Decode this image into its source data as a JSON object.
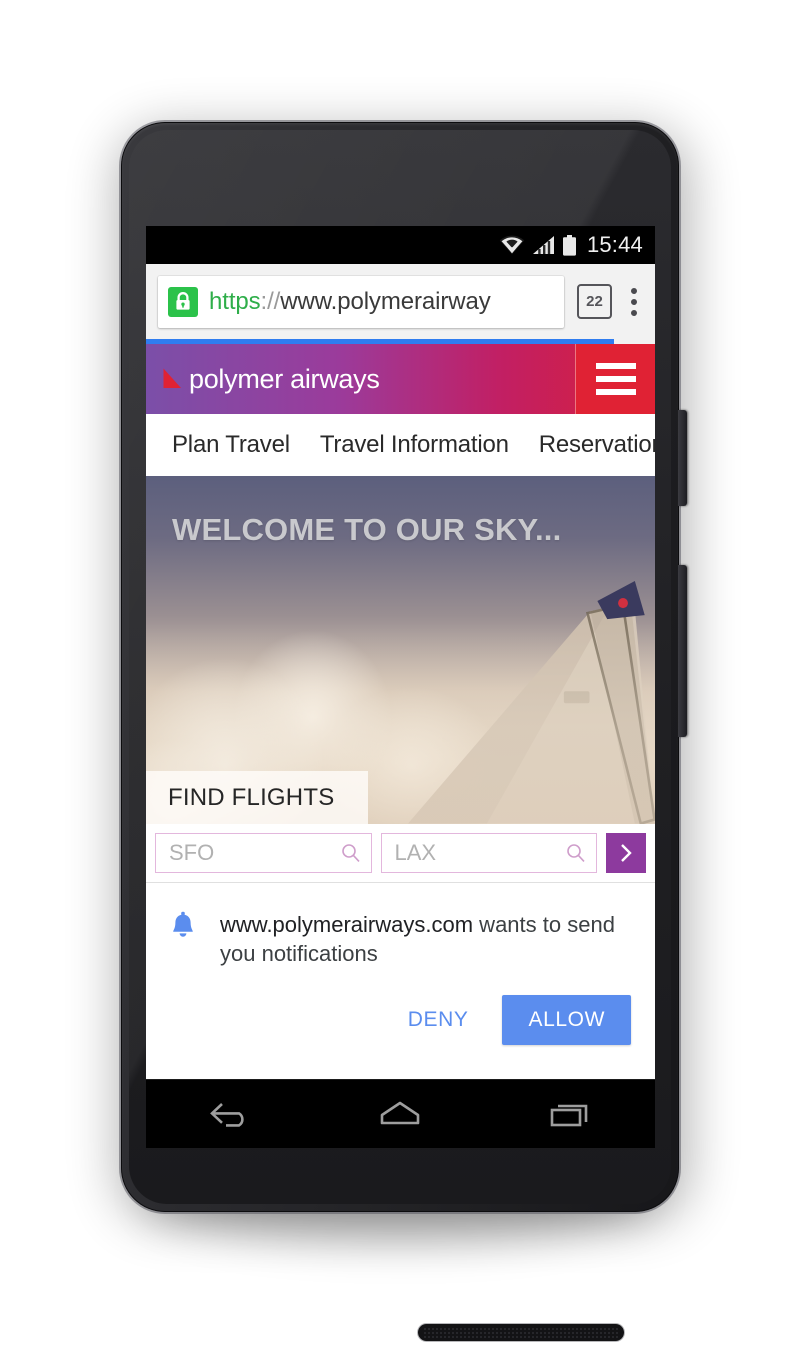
{
  "device": {
    "name": "android-phone",
    "hardware": {
      "front_camera": "front-camera",
      "earpiece": "earpiece-speaker",
      "bottom_speaker": "bottom-speaker",
      "power_button": "power-button",
      "volume_button": "volume-rocker"
    }
  },
  "status_bar": {
    "clock": "15:44",
    "icons": [
      "wifi-icon",
      "cellular-signal-icon",
      "battery-icon"
    ]
  },
  "browser": {
    "url": {
      "scheme": "https",
      "separator": "://",
      "host": "www.polymerairway",
      "full": "https://www.polymerairways.com"
    },
    "lock_icon": "lock-icon",
    "secure": true,
    "tab_count": "22",
    "menu_icon": "kebab-menu-icon",
    "progress_percent": 92,
    "progress_color": "#2f7df0"
  },
  "site": {
    "brand": {
      "name": "polymer airways",
      "logo_icon": "wing-logo-icon"
    },
    "menu_button_label": "hamburger-menu-icon",
    "header_gradient": [
      "#7b4fa8",
      "#9b3b9b",
      "#c21f63",
      "#d8203a"
    ],
    "menu_button_color": "#e02234",
    "nav": [
      {
        "label": "Plan Travel"
      },
      {
        "label": "Travel Information"
      },
      {
        "label": "Reservations"
      }
    ],
    "hero": {
      "title": "WELCOME TO OUR SKY...",
      "tab_label": "FIND FLIGHTS"
    },
    "search": {
      "origin_placeholder": "SFO",
      "origin_value": "",
      "destination_placeholder": "LAX",
      "destination_value": "",
      "search_icon": "magnifier-icon",
      "submit_icon": "chevron-right-icon",
      "submit_color": "#8d3a9e",
      "field_border_color": "#e3b7dd"
    }
  },
  "permission_dialog": {
    "icon": "bell-icon",
    "icon_color": "#5b8dee",
    "host": "www.polymerairways.com",
    "message_rest": " wants to send you notifications",
    "deny_label": "DENY",
    "allow_label": "ALLOW",
    "allow_color": "#5b8dee"
  },
  "android_nav": {
    "back": "back-icon",
    "home": "home-icon",
    "recents": "recents-icon"
  }
}
